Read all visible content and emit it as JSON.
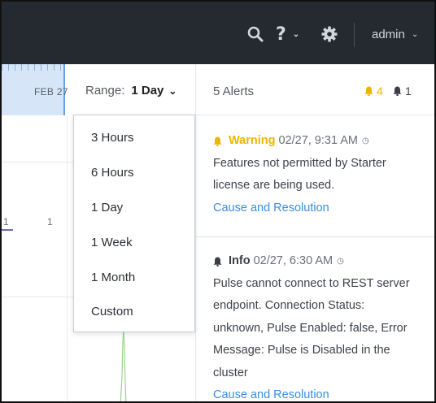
{
  "topbar": {
    "user": "admin"
  },
  "timeline": {
    "date_label": "FEB 27"
  },
  "range": {
    "label": "Range:",
    "value": "1 Day"
  },
  "axis": {
    "left_value": "1",
    "mid_value": "1"
  },
  "range_menu": {
    "options": [
      "3 Hours",
      "6 Hours",
      "1 Day",
      "1 Week",
      "1 Month",
      "Custom"
    ]
  },
  "alerts": {
    "title": "5 Alerts",
    "warning_count": "4",
    "critical_count": "1",
    "items": [
      {
        "severity": "Warning",
        "timestamp": "02/27, 9:31 AM",
        "message_lines": [
          "Features not permitted by Starter",
          "license are being used."
        ],
        "link": "Cause and Resolution"
      },
      {
        "severity": "Info",
        "timestamp": "02/27, 6:30 AM",
        "message_lines": [
          "Pulse cannot connect to REST server",
          "endpoint. Connection Status:",
          "unknown, Pulse Enabled: false, Error",
          "Message: Pulse is Disabled in the",
          "cluster"
        ],
        "link": "Cause and Resolution"
      }
    ]
  },
  "colors": {
    "topbar": "#252a31",
    "warning": "#f0b400",
    "link": "#3b8de0",
    "timeline_fill": "#d7e5f8"
  }
}
